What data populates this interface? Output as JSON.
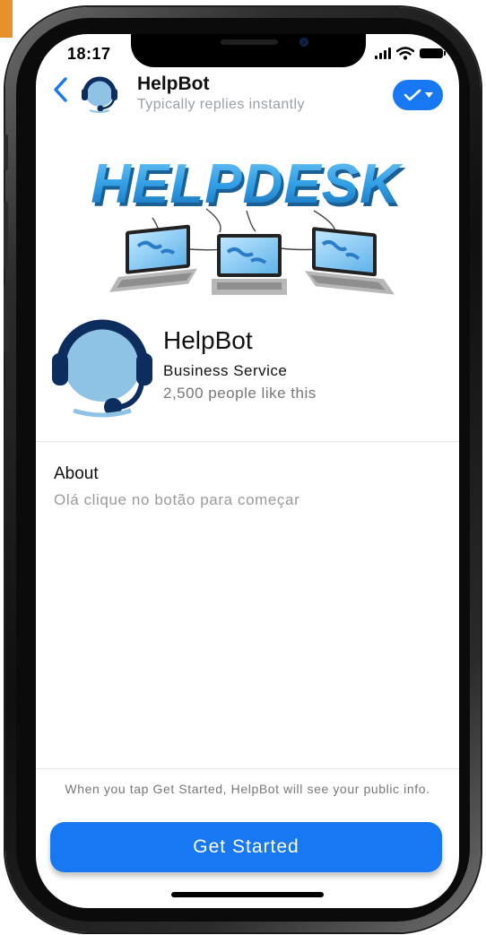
{
  "status_bar": {
    "time": "18:17"
  },
  "header": {
    "title": "HelpBot",
    "subtitle": "Typically replies instantly"
  },
  "banner": {
    "text": "HELPDESK",
    "colors": {
      "text": "#2d9be3",
      "text_shadow": "#1a5f96"
    }
  },
  "profile": {
    "name": "HelpBot",
    "category": "Business Service",
    "likes": "2,500 people like this",
    "avatar_colors": {
      "face": "#8fc3e6",
      "headset": "#0c2d5e"
    }
  },
  "about": {
    "title": "About",
    "text": "Olá clique no botão para começar"
  },
  "footer": {
    "notice": "When you tap Get Started, HelpBot will see your public info.",
    "cta_label": "Get Started"
  },
  "colors": {
    "accent": "#1877f2",
    "muted_text": "#9a9a9a",
    "border_decor": "#e8912c"
  },
  "icons": [
    "back-chevron-icon",
    "bot-avatar-icon",
    "checkmark-dropdown-icon",
    "signal-icon",
    "wifi-icon",
    "battery-icon"
  ]
}
